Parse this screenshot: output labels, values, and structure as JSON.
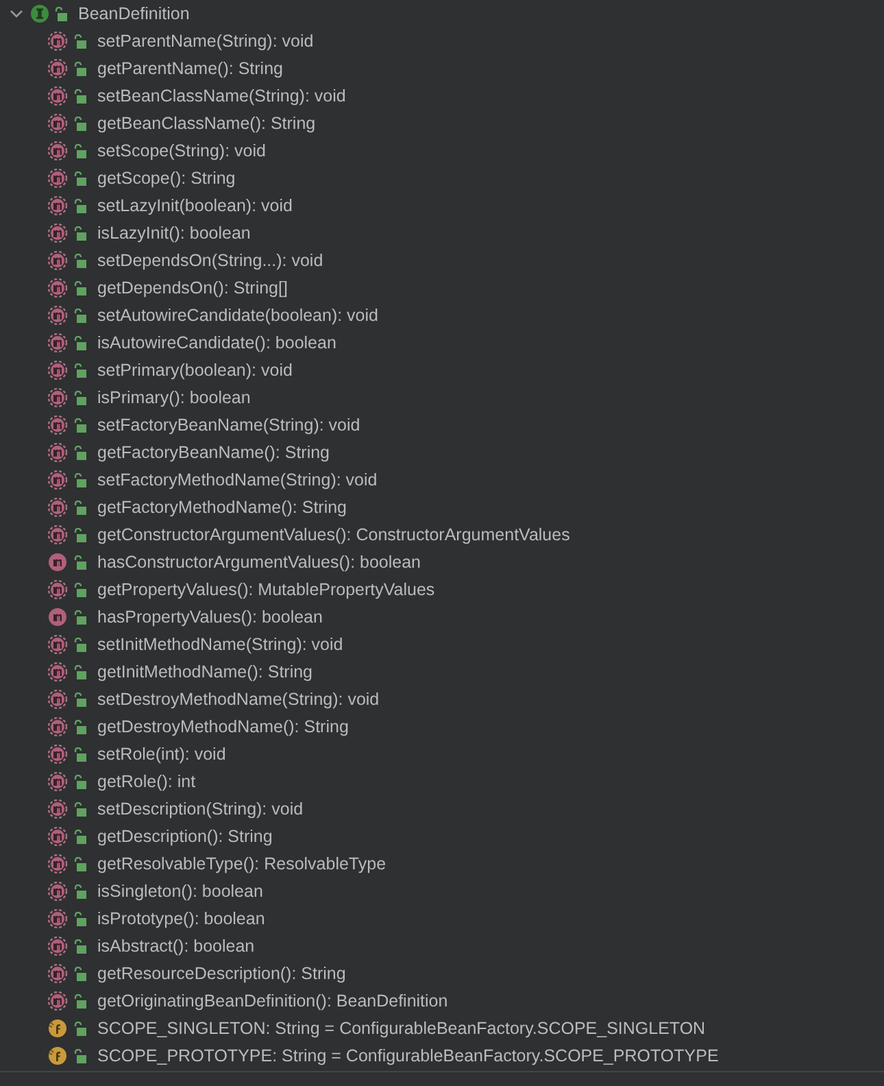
{
  "tree": {
    "label": "BeanDefinition",
    "kind": "interface",
    "expanded": true,
    "children": [
      {
        "kind": "abstract",
        "label": "setParentName(String): void"
      },
      {
        "kind": "abstract",
        "label": "getParentName(): String"
      },
      {
        "kind": "abstract",
        "label": "setBeanClassName(String): void"
      },
      {
        "kind": "abstract",
        "label": "getBeanClassName(): String"
      },
      {
        "kind": "abstract",
        "label": "setScope(String): void"
      },
      {
        "kind": "abstract",
        "label": "getScope(): String"
      },
      {
        "kind": "abstract",
        "label": "setLazyInit(boolean): void"
      },
      {
        "kind": "abstract",
        "label": "isLazyInit(): boolean"
      },
      {
        "kind": "abstract",
        "label": "setDependsOn(String...): void"
      },
      {
        "kind": "abstract",
        "label": "getDependsOn(): String[]"
      },
      {
        "kind": "abstract",
        "label": "setAutowireCandidate(boolean): void"
      },
      {
        "kind": "abstract",
        "label": "isAutowireCandidate(): boolean"
      },
      {
        "kind": "abstract",
        "label": "setPrimary(boolean): void"
      },
      {
        "kind": "abstract",
        "label": "isPrimary(): boolean"
      },
      {
        "kind": "abstract",
        "label": "setFactoryBeanName(String): void"
      },
      {
        "kind": "abstract",
        "label": "getFactoryBeanName(): String"
      },
      {
        "kind": "abstract",
        "label": "setFactoryMethodName(String): void"
      },
      {
        "kind": "abstract",
        "label": "getFactoryMethodName(): String"
      },
      {
        "kind": "abstract",
        "label": "getConstructorArgumentValues(): ConstructorArgumentValues"
      },
      {
        "kind": "method",
        "label": "hasConstructorArgumentValues(): boolean"
      },
      {
        "kind": "abstract",
        "label": "getPropertyValues(): MutablePropertyValues"
      },
      {
        "kind": "method",
        "label": "hasPropertyValues(): boolean"
      },
      {
        "kind": "abstract",
        "label": "setInitMethodName(String): void"
      },
      {
        "kind": "abstract",
        "label": "getInitMethodName(): String"
      },
      {
        "kind": "abstract",
        "label": "setDestroyMethodName(String): void"
      },
      {
        "kind": "abstract",
        "label": "getDestroyMethodName(): String"
      },
      {
        "kind": "abstract",
        "label": "setRole(int): void"
      },
      {
        "kind": "abstract",
        "label": "getRole(): int"
      },
      {
        "kind": "abstract",
        "label": "setDescription(String): void"
      },
      {
        "kind": "abstract",
        "label": "getDescription(): String"
      },
      {
        "kind": "abstract",
        "label": "getResolvableType(): ResolvableType"
      },
      {
        "kind": "abstract",
        "label": "isSingleton(): boolean"
      },
      {
        "kind": "abstract",
        "label": "isPrototype(): boolean"
      },
      {
        "kind": "abstract",
        "label": "isAbstract(): boolean"
      },
      {
        "kind": "abstract",
        "label": "getResourceDescription(): String"
      },
      {
        "kind": "abstract",
        "label": "getOriginatingBeanDefinition(): BeanDefinition"
      },
      {
        "kind": "field",
        "label": "SCOPE_SINGLETON: String = ConfigurableBeanFactory.SCOPE_SINGLETON"
      },
      {
        "kind": "field",
        "label": "SCOPE_PROTOTYPE: String = ConfigurableBeanFactory.SCOPE_PROTOTYPE"
      }
    ]
  }
}
